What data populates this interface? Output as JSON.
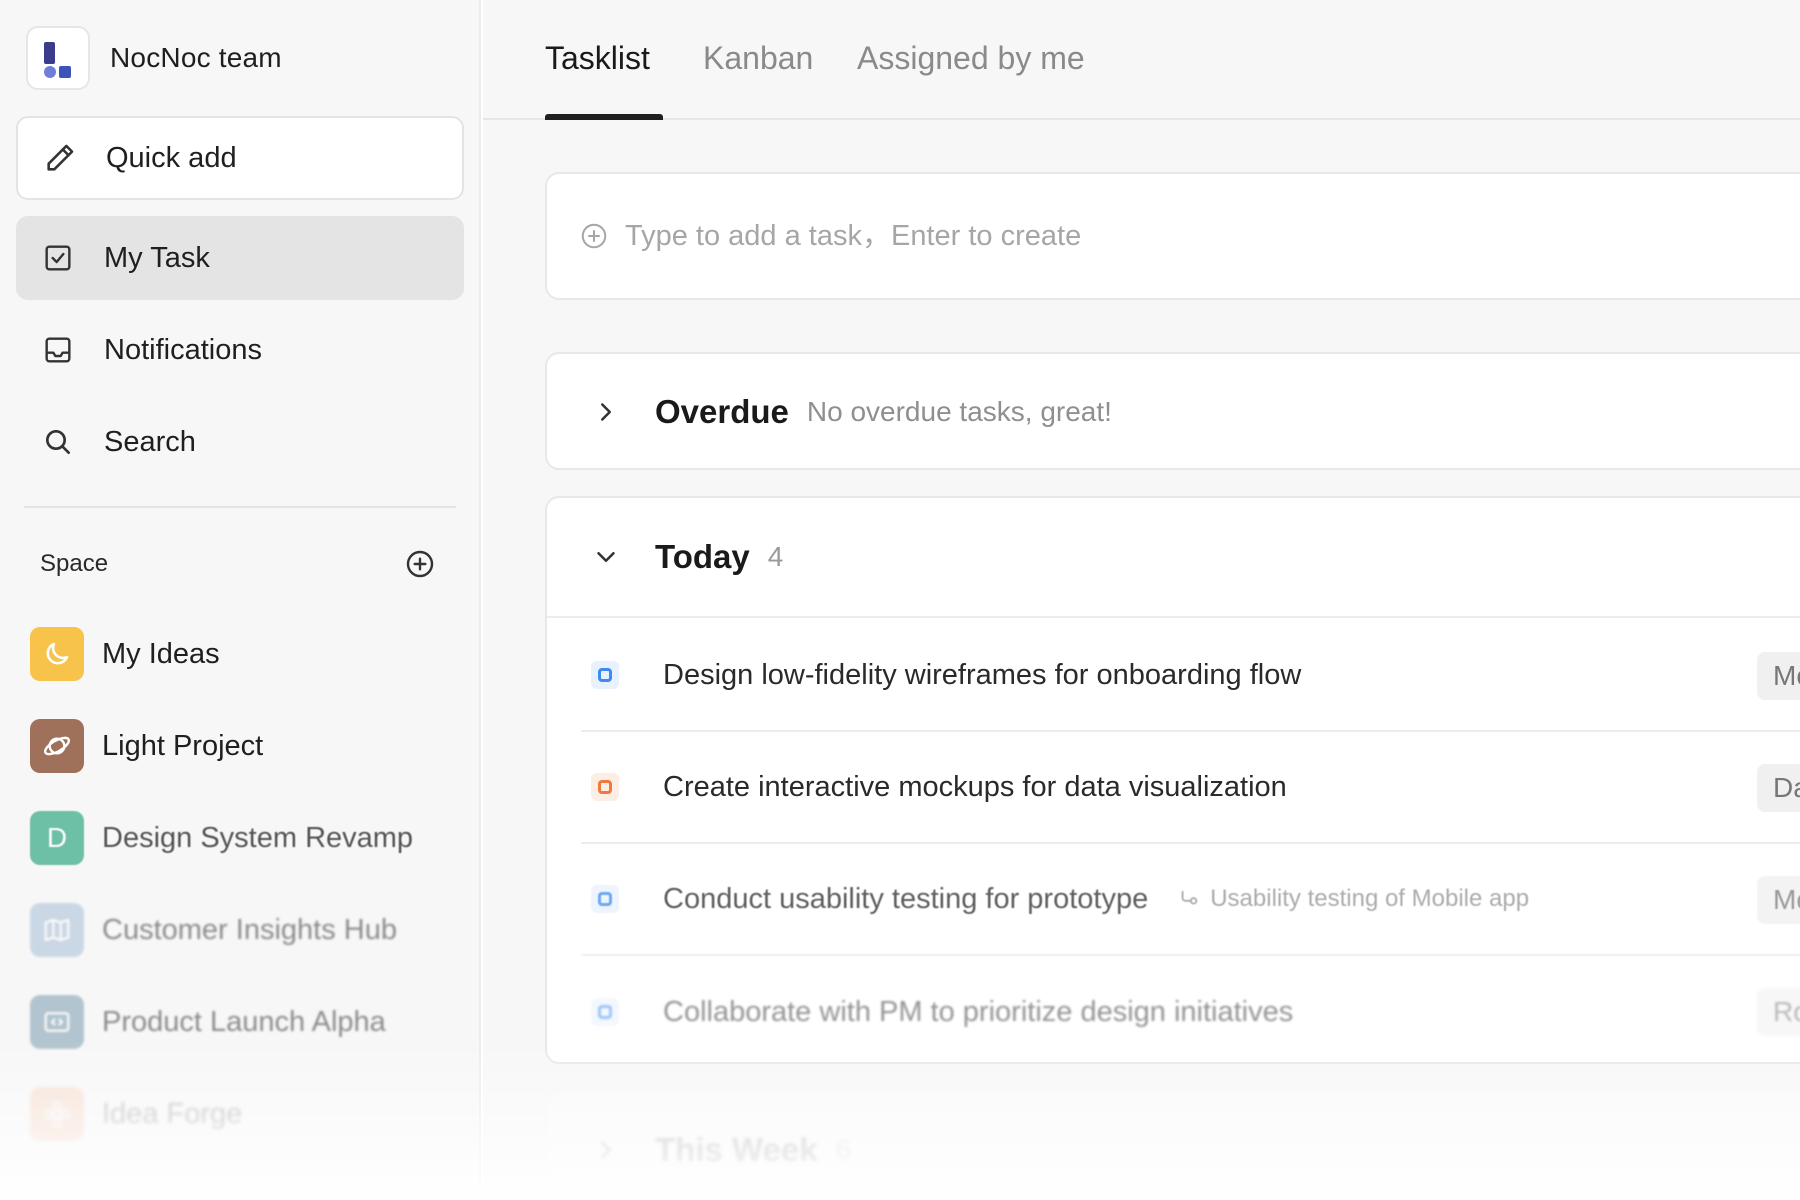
{
  "sidebar": {
    "team_name": "NocNoc team",
    "nav": [
      {
        "label": "Quick add",
        "icon": "pencil-icon"
      },
      {
        "label": "My Task",
        "icon": "checkbox-icon"
      },
      {
        "label": "Notifications",
        "icon": "inbox-icon"
      },
      {
        "label": "Search",
        "icon": "search-icon"
      }
    ],
    "space_title": "Space",
    "spaces": [
      {
        "label": "My Ideas",
        "icon": "moon-icon",
        "color": "#f7c34a"
      },
      {
        "label": "Light Project",
        "icon": "planet-icon",
        "color": "#a0715a"
      },
      {
        "label": "Design System Revamp",
        "icon": "letter-d-icon",
        "letter": "D",
        "color": "#3fae8c"
      },
      {
        "label": "Customer Insights Hub",
        "icon": "map-icon",
        "color": "#9fb9d4"
      },
      {
        "label": "Product Launch Alpha",
        "icon": "code-icon",
        "color": "#6f93a8"
      },
      {
        "label": "Idea Forge",
        "icon": "flower-icon",
        "color": "#f5a97f"
      }
    ]
  },
  "tabs": [
    "Tasklist",
    "Kanban",
    "Assigned by me"
  ],
  "add_task": {
    "placeholder": "Type to add a task，Enter to create"
  },
  "overdue": {
    "title": "Overdue",
    "subtitle": "No overdue tasks, great!"
  },
  "today": {
    "title": "Today",
    "count": "4",
    "tasks": [
      {
        "title": "Design low-fidelity wireframes for onboarding flow",
        "subtask": "",
        "tag": "Mobile a",
        "check_color": "#3d8bf0"
      },
      {
        "title": "Create interactive mockups for data visualization",
        "subtask": "",
        "tag": "Dashboa",
        "check_color": "#f07a3d"
      },
      {
        "title": "Conduct usability testing for prototype",
        "subtask": "Usability testing of Mobile app",
        "tag": "Mobile a",
        "check_color": "#3d8bf0"
      },
      {
        "title": "Collaborate with PM to prioritize design initiatives",
        "subtask": "",
        "tag": "Roadma",
        "check_color": "#3d8bf0"
      }
    ]
  },
  "this_week": {
    "title": "This Week",
    "count": "6"
  }
}
